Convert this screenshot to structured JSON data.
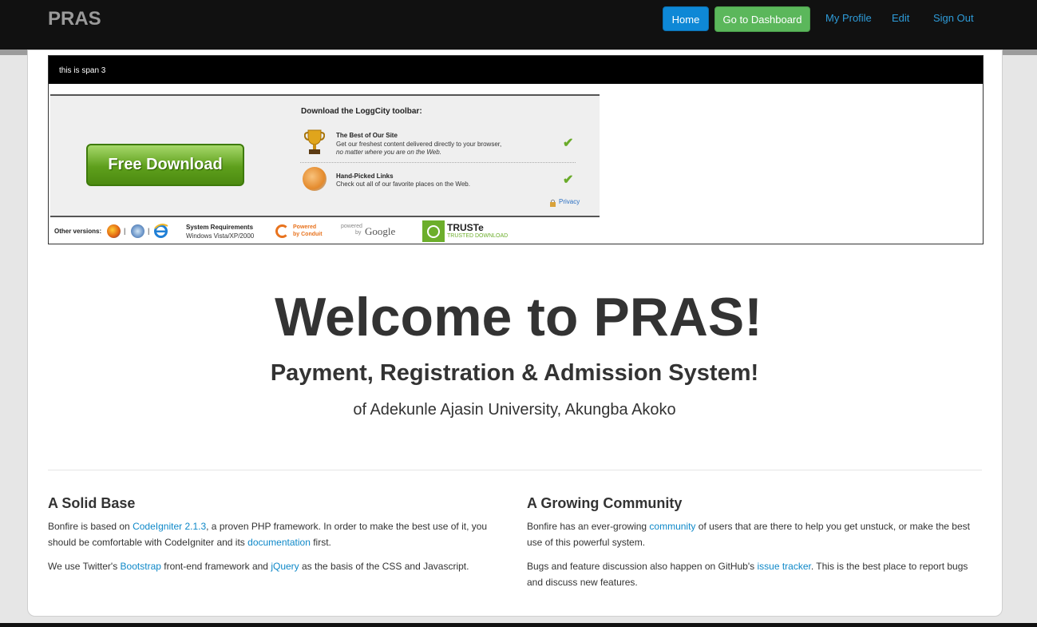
{
  "navbar": {
    "brand": "PRAS",
    "home_label": "Home",
    "dashboard_label": "Go to Dashboard",
    "profile_label": "My Profile",
    "edit_label": "Edit",
    "signout_label": "Sign Out"
  },
  "span_box": {
    "header": "this is span 3"
  },
  "toolbar_ad": {
    "download_button": "Free Download",
    "title": "Download the LoggCity toolbar:",
    "item1_title": "The Best of Our Site",
    "item1_line1": "Get our freshest content delivered directly to your browser,",
    "item1_line2": "no matter where you are on the Web.",
    "item2_title": "Hand-Picked Links",
    "item2_line1": "Check out all of our favorite places on the Web.",
    "check_glyph": "✔",
    "privacy": "Privacy",
    "other_versions": "Other versions:",
    "separator": "|",
    "sysreq_title": "System Requirements",
    "sysreq_text": "Windows Vista/XP/2000",
    "conduit_line1": "Powered",
    "conduit_line2": "by Conduit",
    "powered_line1": "powered",
    "powered_line2": "by",
    "google": "Google",
    "truste": "TRUSTe",
    "truste_sub": "TRUSTED DOWNLOAD"
  },
  "hero": {
    "title": "Welcome to PRAS!",
    "subtitle": "Payment, Registration & Admission System!",
    "subtitle2": "of Adekunle Ajasin University, Akungba Akoko"
  },
  "left_col": {
    "heading": "A Solid Base",
    "p1_pre": "Bonfire is based on ",
    "p1_link1": "CodeIgniter 2.1.3",
    "p1_mid": ", a proven PHP framework. In order to make the best use of it, you should be comfortable with CodeIgniter and its ",
    "p1_link2": "documentation",
    "p1_post": " first.",
    "p2_pre": "We use Twitter's ",
    "p2_link1": "Bootstrap",
    "p2_mid": " front-end framework and ",
    "p2_link2": "jQuery",
    "p2_post": " as the basis of the CSS and Javascript."
  },
  "right_col": {
    "heading": "A Growing Community",
    "p1_pre": "Bonfire has an ever-growing ",
    "p1_link": "community",
    "p1_post": " of users that are there to help you get unstuck, or make the best use of this powerful system.",
    "p2_pre": "Bugs and feature discussion also happen on GitHub's ",
    "p2_link": "issue tracker",
    "p2_post": ". This is the best place to report bugs and discuss new features."
  },
  "colors": {
    "navbar_bg": "#111111",
    "home_btn": "#0e88d6",
    "dashboard_btn": "#5bb75b",
    "link": "#0e88c8"
  }
}
